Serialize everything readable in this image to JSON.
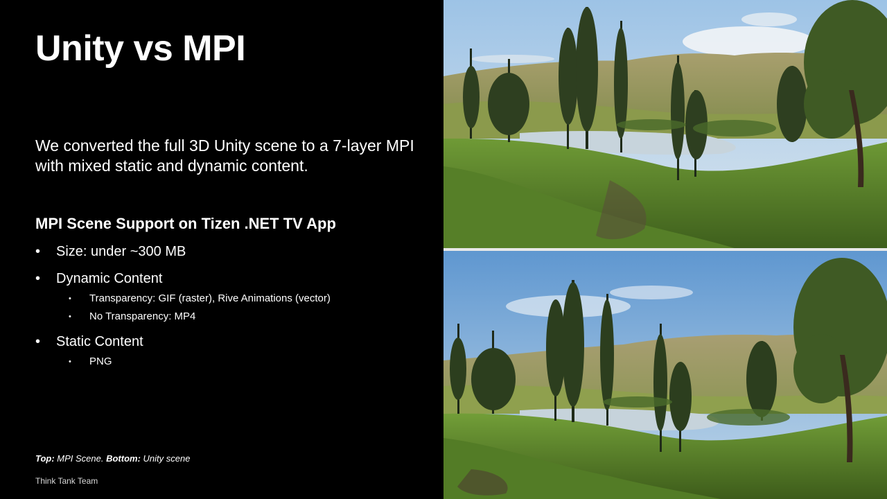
{
  "slide": {
    "title": "Unity vs MPI",
    "intro": "We converted the full 3D Unity scene to a 7-layer MPI with mixed static and dynamic content.",
    "section_heading": "MPI Scene Support on Tizen .NET TV App",
    "bullets": [
      {
        "label": "Size: under ~300 MB",
        "sub": []
      },
      {
        "label": "Dynamic Content",
        "sub": [
          "Transparency: GIF (raster), Rive Animations (vector)",
          "No Transparency: MP4"
        ]
      },
      {
        "label": "Static Content",
        "sub": [
          "PNG"
        ]
      }
    ],
    "caption": {
      "top_label": "Top:",
      "top_text": " MPI Scene. ",
      "bottom_label": "Bottom:",
      "bottom_text": " Unity scene"
    },
    "footer": "Think Tank Team"
  },
  "colors": {
    "background": "#000000",
    "text": "#ffffff",
    "sky": "#8fb4d8",
    "grass": "#5f8a2e",
    "hill": "#9a9a62",
    "water": "#c9d6de"
  }
}
